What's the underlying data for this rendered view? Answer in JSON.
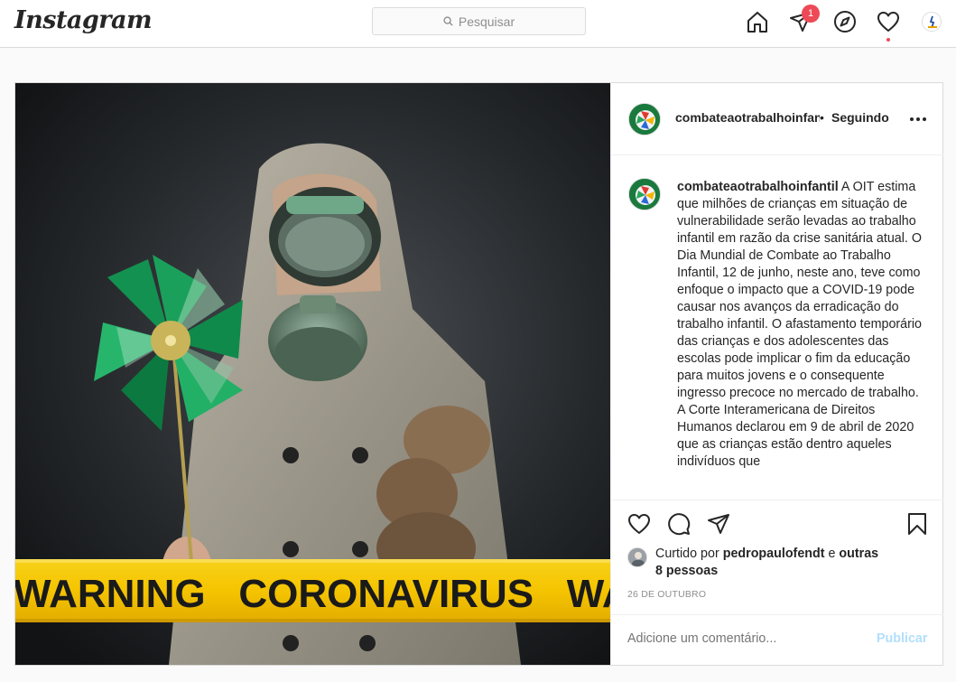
{
  "app": {
    "logo_text": "Instagram"
  },
  "search": {
    "placeholder": "Pesquisar",
    "icon": "search-icon"
  },
  "nav": {
    "home_icon": "home-icon",
    "direct_icon": "direct-paper-plane-icon",
    "direct_badge": "1",
    "explore_icon": "compass-icon",
    "activity_icon": "heart-icon",
    "profile_icon": "avatar"
  },
  "post": {
    "username": "combateaotrabalhoinfantil",
    "header_username": "combateaotrabalhoinfantil",
    "separator": "•",
    "follow_status": "Seguindo",
    "caption": "A OIT estima que milhões de crianças em situação de vulnerabilidade serão levadas ao trabalho infantil em razão da crise sanitária atual. O Dia Mundial de Combate ao Trabalho Infantil, 12 de junho, neste ano, teve como enfoque o impacto que a COVID-19 pode causar nos avanços da erradicação do trabalho infantil. O afastamento temporário das crianças e dos adolescentes das escolas pode implicar o fim da educação para muitos jovens e o consequente ingresso precoce no mercado de trabalho. A Corte Interamericana de Direitos Humanos declarou em 9 de abril de 2020 que as crianças estão dentro aqueles indivíduos que",
    "image_banner_text": "WARNING   CORONAVIRUS   WARNING",
    "likes": {
      "prefix": "Curtido por",
      "user": "pedropaulofendt",
      "conjunction": "e",
      "others": "outras 8 pessoas"
    },
    "date": "26 DE OUTUBRO",
    "comment_placeholder": "Adicione um comentário...",
    "publish_label": "Publicar"
  },
  "colors": {
    "accent": "#0095f6",
    "publish_disabled": "#b2dffc",
    "badge": "#ed4956",
    "border": "#dbdbdb",
    "tape_yellow": "#f5c400"
  }
}
